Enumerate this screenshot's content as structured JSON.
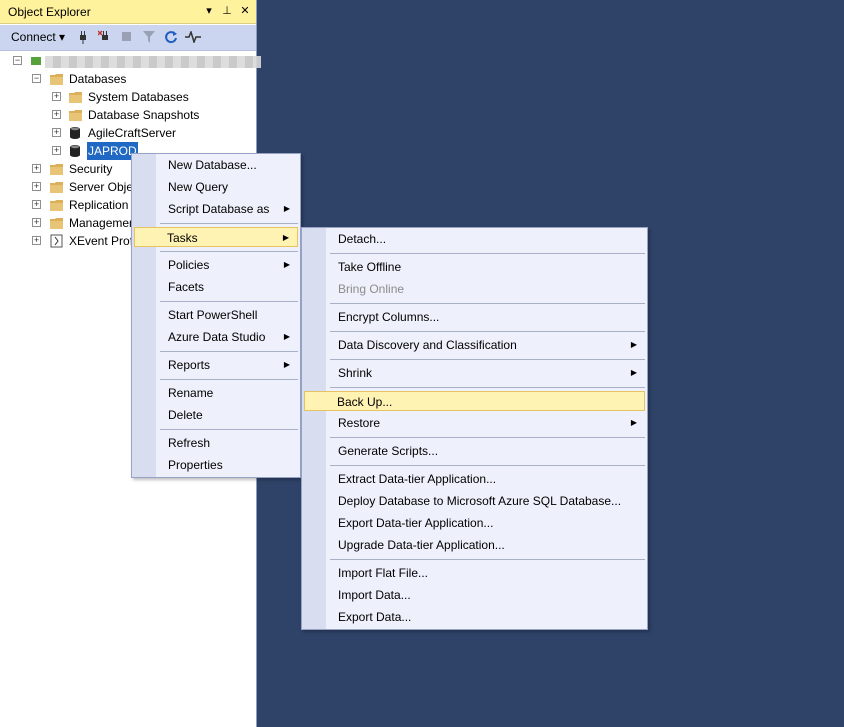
{
  "panel": {
    "title": "Object Explorer",
    "pin_glyph": "▾",
    "pushpin_glyph": "⊥",
    "close_glyph": "✕"
  },
  "toolbar": {
    "connect_label": "Connect ▾",
    "icons": [
      "connect-object-explorer-icon",
      "disconnect-icon",
      "stop-icon",
      "filter-icon",
      "refresh-icon",
      "activity-monitor-icon"
    ]
  },
  "tree": {
    "databases": "Databases",
    "system_databases": "System Databases",
    "database_snapshots": "Database Snapshots",
    "agile_craft": "AgileCraftServer",
    "japrod": "JAPROD",
    "security": "Security",
    "server_objects": "Server Objec",
    "replication": "Replication",
    "management": "Managemen",
    "xevent": "XEvent Prof"
  },
  "context_menu": {
    "new_database": "New Database...",
    "new_query": "New Query",
    "script_database_as": "Script Database as",
    "tasks": "Tasks",
    "policies": "Policies",
    "facets": "Facets",
    "start_powershell": "Start PowerShell",
    "azure_data_studio": "Azure Data Studio",
    "reports": "Reports",
    "rename": "Rename",
    "delete": "Delete",
    "refresh": "Refresh",
    "properties": "Properties"
  },
  "tasks_menu": {
    "detach": "Detach...",
    "take_offline": "Take Offline",
    "bring_online": "Bring Online",
    "encrypt_columns": "Encrypt Columns...",
    "data_discovery": "Data Discovery and Classification",
    "shrink": "Shrink",
    "back_up": "Back Up...",
    "restore": "Restore",
    "generate_scripts": "Generate Scripts...",
    "extract_dac": "Extract Data-tier Application...",
    "deploy_azure": "Deploy Database to Microsoft Azure SQL Database...",
    "export_dac": "Export Data-tier Application...",
    "upgrade_dac": "Upgrade Data-tier Application...",
    "import_flat": "Import Flat File...",
    "import_data": "Import Data...",
    "export_data": "Export Data..."
  },
  "colors": {
    "background": "#2f4368",
    "title_bar": "#fff29d",
    "highlight": "#fff3b4",
    "selection": "#1f68c4"
  }
}
